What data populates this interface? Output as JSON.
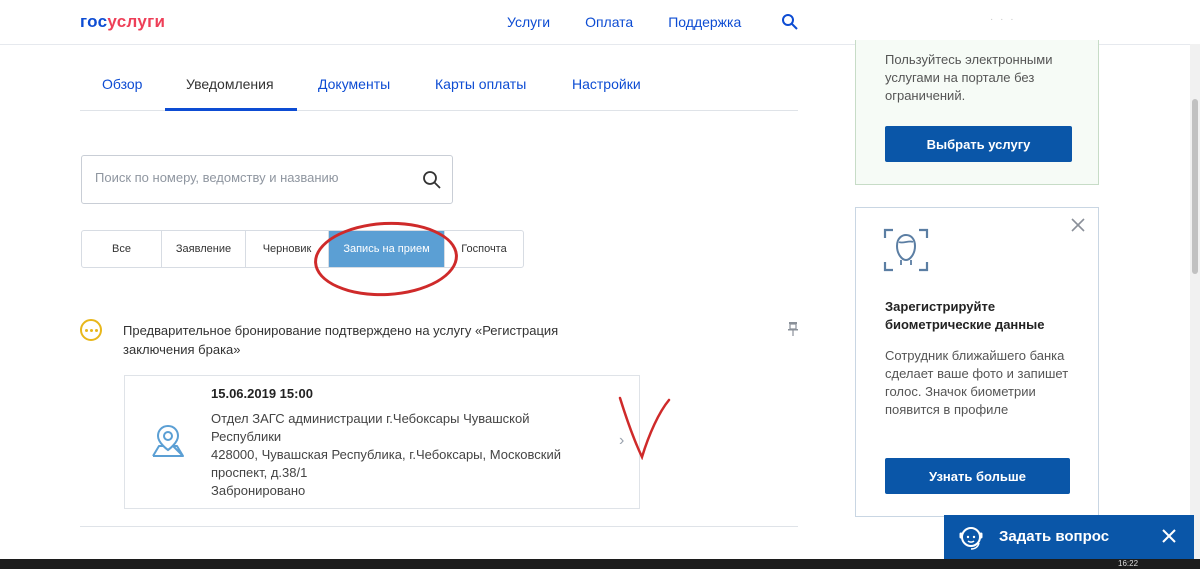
{
  "header": {
    "logo_part1": "гос",
    "logo_part2": "услуги",
    "nav": [
      "Услуги",
      "Оплата",
      "Поддержка"
    ]
  },
  "tabs": [
    "Обзор",
    "Уведомления",
    "Документы",
    "Карты оплаты",
    "Настройки"
  ],
  "active_tab": "Уведомления",
  "search": {
    "placeholder": "Поиск по номеру, ведомству и названию"
  },
  "filters": [
    "Все",
    "Заявление",
    "Черновик",
    "Запись на прием",
    "Госпочта"
  ],
  "active_filter": "Запись на прием",
  "notification": {
    "text": "Предварительное бронирование подтверждено на услугу «Регистрация заключения брака»",
    "booking": {
      "datetime": "15.06.2019 15:00",
      "office": "Отдел ЗАГС администрации г.Чебоксары Чувашской Республики",
      "address": "428000, Чувашская Республика, г.Чебоксары, Московский проспект, д.38/1",
      "status": "Забронировано"
    }
  },
  "sidebar": {
    "promo_text": "Пользуйтесь электронными услугами на портале без ограничений.",
    "promo_button": "Выбрать услугу",
    "bio_title": "Зарегистрируйте биометрические данные",
    "bio_desc": "Сотрудник ближайшего банка сделает ваше фото и запишет голос. Значок биометрии появится в профиле",
    "bio_button": "Узнать больше"
  },
  "chat": {
    "label": "Задать вопрос"
  },
  "taskbar": {
    "clock": "16:22"
  },
  "colors": {
    "brand_blue": "#0d4cd3",
    "button_blue": "#0a56a8",
    "brand_red": "#ee3f58",
    "filter_active": "#5b9fd4",
    "annotation_red": "#cf2a2a"
  }
}
